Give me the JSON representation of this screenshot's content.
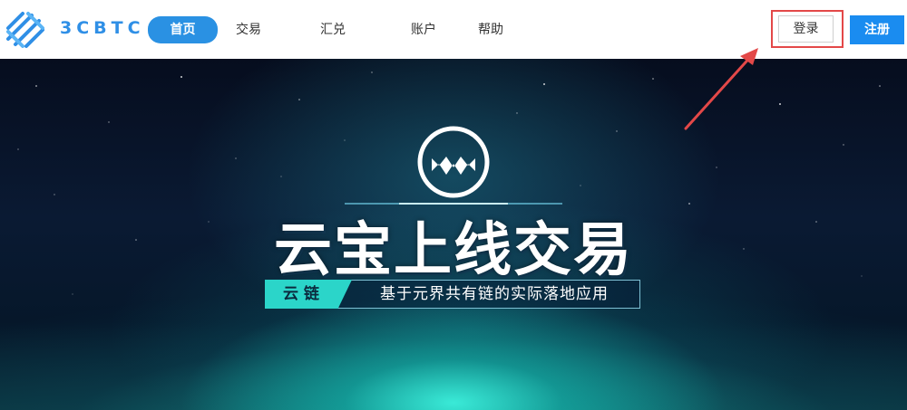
{
  "header": {
    "logo_text": "3CBTC",
    "nav": [
      {
        "label": "首页",
        "active": true
      },
      {
        "label": "交易",
        "active": false
      },
      {
        "label": "汇兑",
        "active": false
      },
      {
        "label": "账户",
        "active": false
      },
      {
        "label": "帮助",
        "active": false
      }
    ],
    "login_label": "登录",
    "register_label": "注册"
  },
  "banner": {
    "title": "云宝上线交易",
    "tag": "云链",
    "tagline": "基于元界共有链的实际落地应用"
  },
  "colors": {
    "brand_blue": "#2a91e3",
    "register_blue": "#1a8cf0",
    "highlight_red": "#e34848",
    "tag_cyan": "#2bd5c9"
  },
  "icons": [
    "3cbtc-logo-icon",
    "metaverse-logo-icon",
    "annotation-arrow-icon"
  ]
}
